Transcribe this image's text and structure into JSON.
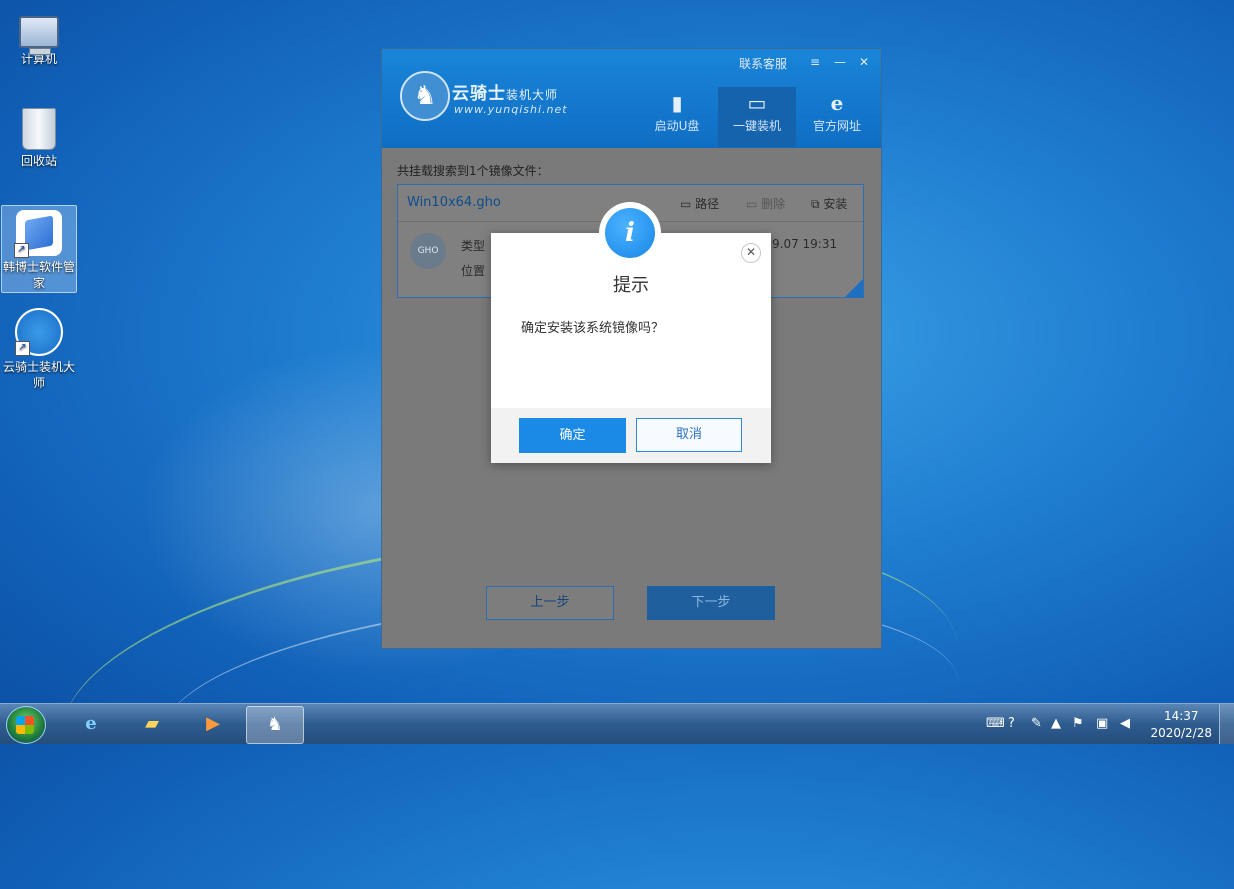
{
  "desktop": {
    "icons": [
      {
        "label": "计算机"
      },
      {
        "label": "回收站"
      },
      {
        "label": "韩博士软件管家"
      },
      {
        "label": "云骑士装机大师"
      }
    ]
  },
  "app": {
    "brand": "云骑士",
    "brand_sub": "装机大师",
    "url": "www.yunqishi.net",
    "window_controls": {
      "service": "联系客服",
      "menu": "≡",
      "minimize": "—",
      "close": "✕"
    },
    "tabs": [
      {
        "label": "启动U盘",
        "icon": "usb-icon"
      },
      {
        "label": "一键装机",
        "icon": "monitor-icon",
        "active": true
      },
      {
        "label": "官方网址",
        "icon": "ie-icon"
      }
    ],
    "found_label": "共挂载搜索到1个镜像文件：",
    "image": {
      "name": "Win10x64.gho",
      "actions": {
        "path": "路径",
        "delete": "删除",
        "install": "安装"
      },
      "badge": "GHO",
      "type_label": "类型",
      "location_label": "位置",
      "date_fragment": "9.07 19:31"
    },
    "prev_button": "上一步",
    "next_button": "下一步"
  },
  "dialog": {
    "icon": "i",
    "title": "提示",
    "message": "确定安装该系统镜像吗？",
    "ok": "确定",
    "cancel": "取消",
    "close": "✕"
  },
  "taskbar": {
    "time": "14:37",
    "date": "2020/2/28"
  }
}
